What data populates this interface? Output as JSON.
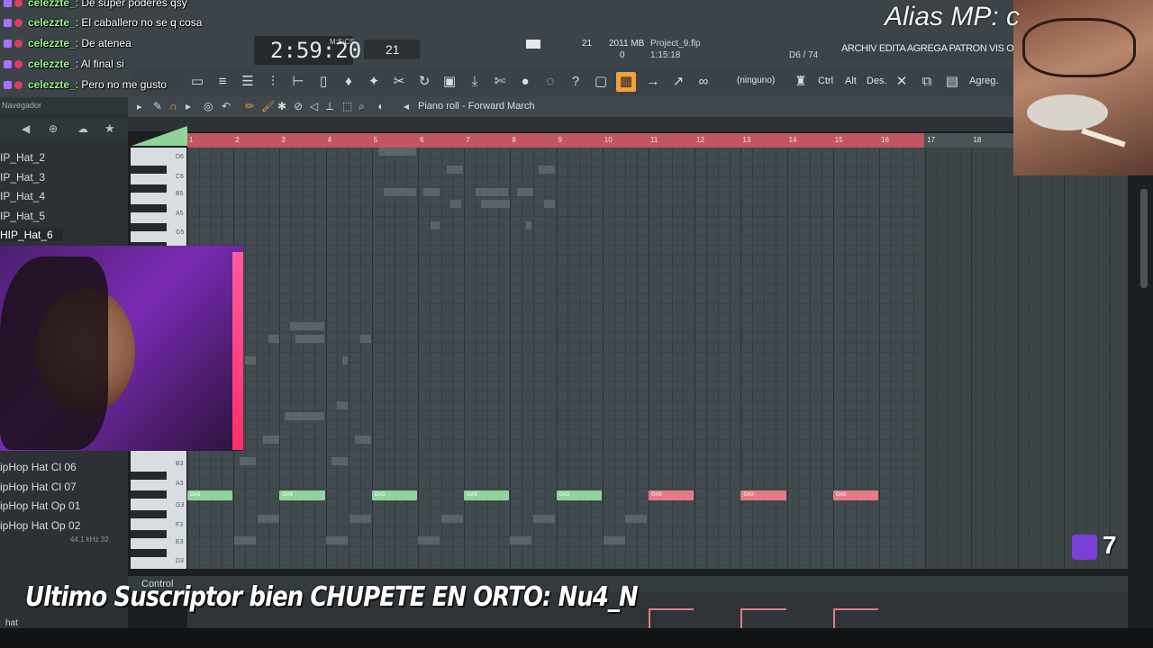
{
  "chat": [
    {
      "user": "celezzte_",
      "message": "De super poderes qsy"
    },
    {
      "user": "celezzte_",
      "message": "El caballero no se q cosa"
    },
    {
      "user": "celezzte_",
      "message": "De atenea"
    },
    {
      "user": "celezzte_",
      "message": "Al final si"
    },
    {
      "user": "celezzte_",
      "message": "Pero no me gusto"
    }
  ],
  "overlay": {
    "alias": "Alias MP: c",
    "subscriber_banner": "Ultimo Suscriptor bien CHUPETE EN ORTO: Nu4_N",
    "twitch_count": "7",
    "twitch_color": "#7a3fd6"
  },
  "toolbar": {
    "time": "2:59:20",
    "time_unit": "M:S:CS",
    "tempo": "21",
    "cpu": "21",
    "memory": "2011 MB",
    "voices": "0",
    "project_name": "Project_9.flp",
    "project_time": "1:15:18",
    "note_info": "D6 / 74",
    "menu": "ARCHIV EDITA AGREGA PATRON VIS OPCIONES",
    "pattern_select": "(ninguno)",
    "ctrl_label": "Ctrl",
    "alt_label": "Alt",
    "des_label": "Des.",
    "agreg_label": "Agreg."
  },
  "browser": {
    "title": "Navegador",
    "items_top": [
      "IP_Hat_2",
      "IP_Hat_3",
      "IP_Hat_4",
      "IP_Hat_5",
      "HIP_Hat_6"
    ],
    "items_bottom": [
      "ipHop Hat Cl 06",
      "ipHop Hat Cl 07",
      "ipHop Hat Op 01",
      "ipHop Hat Op 02"
    ],
    "sample_info": "44.1 kHz 32",
    "search_value": "hat"
  },
  "piano_roll": {
    "title": "Piano roll - Forward March",
    "bars": [
      "1",
      "2",
      "3",
      "4",
      "5",
      "6",
      "7",
      "8",
      "9",
      "10",
      "11",
      "12",
      "13",
      "14",
      "15",
      "16",
      "17",
      "18"
    ],
    "key_labels": [
      "D6",
      "C6",
      "B5",
      "A5",
      "G5",
      "B3",
      "A3",
      "G3",
      "F3",
      "E3",
      "D3"
    ],
    "notes": [
      {
        "label": "G#3",
        "bar_start": 1,
        "length": 1,
        "color": "green"
      },
      {
        "label": "G#3",
        "bar_start": 3,
        "length": 1,
        "color": "green"
      },
      {
        "label": "G#3",
        "bar_start": 5,
        "length": 1,
        "color": "green"
      },
      {
        "label": "G#3",
        "bar_start": 7,
        "length": 1,
        "color": "green"
      },
      {
        "label": "G#3",
        "bar_start": 9,
        "length": 1,
        "color": "green"
      },
      {
        "label": "G#3",
        "bar_start": 11,
        "length": 1,
        "color": "red"
      },
      {
        "label": "G#3",
        "bar_start": 13,
        "length": 1,
        "color": "red"
      },
      {
        "label": "G#3",
        "bar_start": 15,
        "length": 1,
        "color": "red"
      }
    ],
    "control_label": "Control"
  }
}
